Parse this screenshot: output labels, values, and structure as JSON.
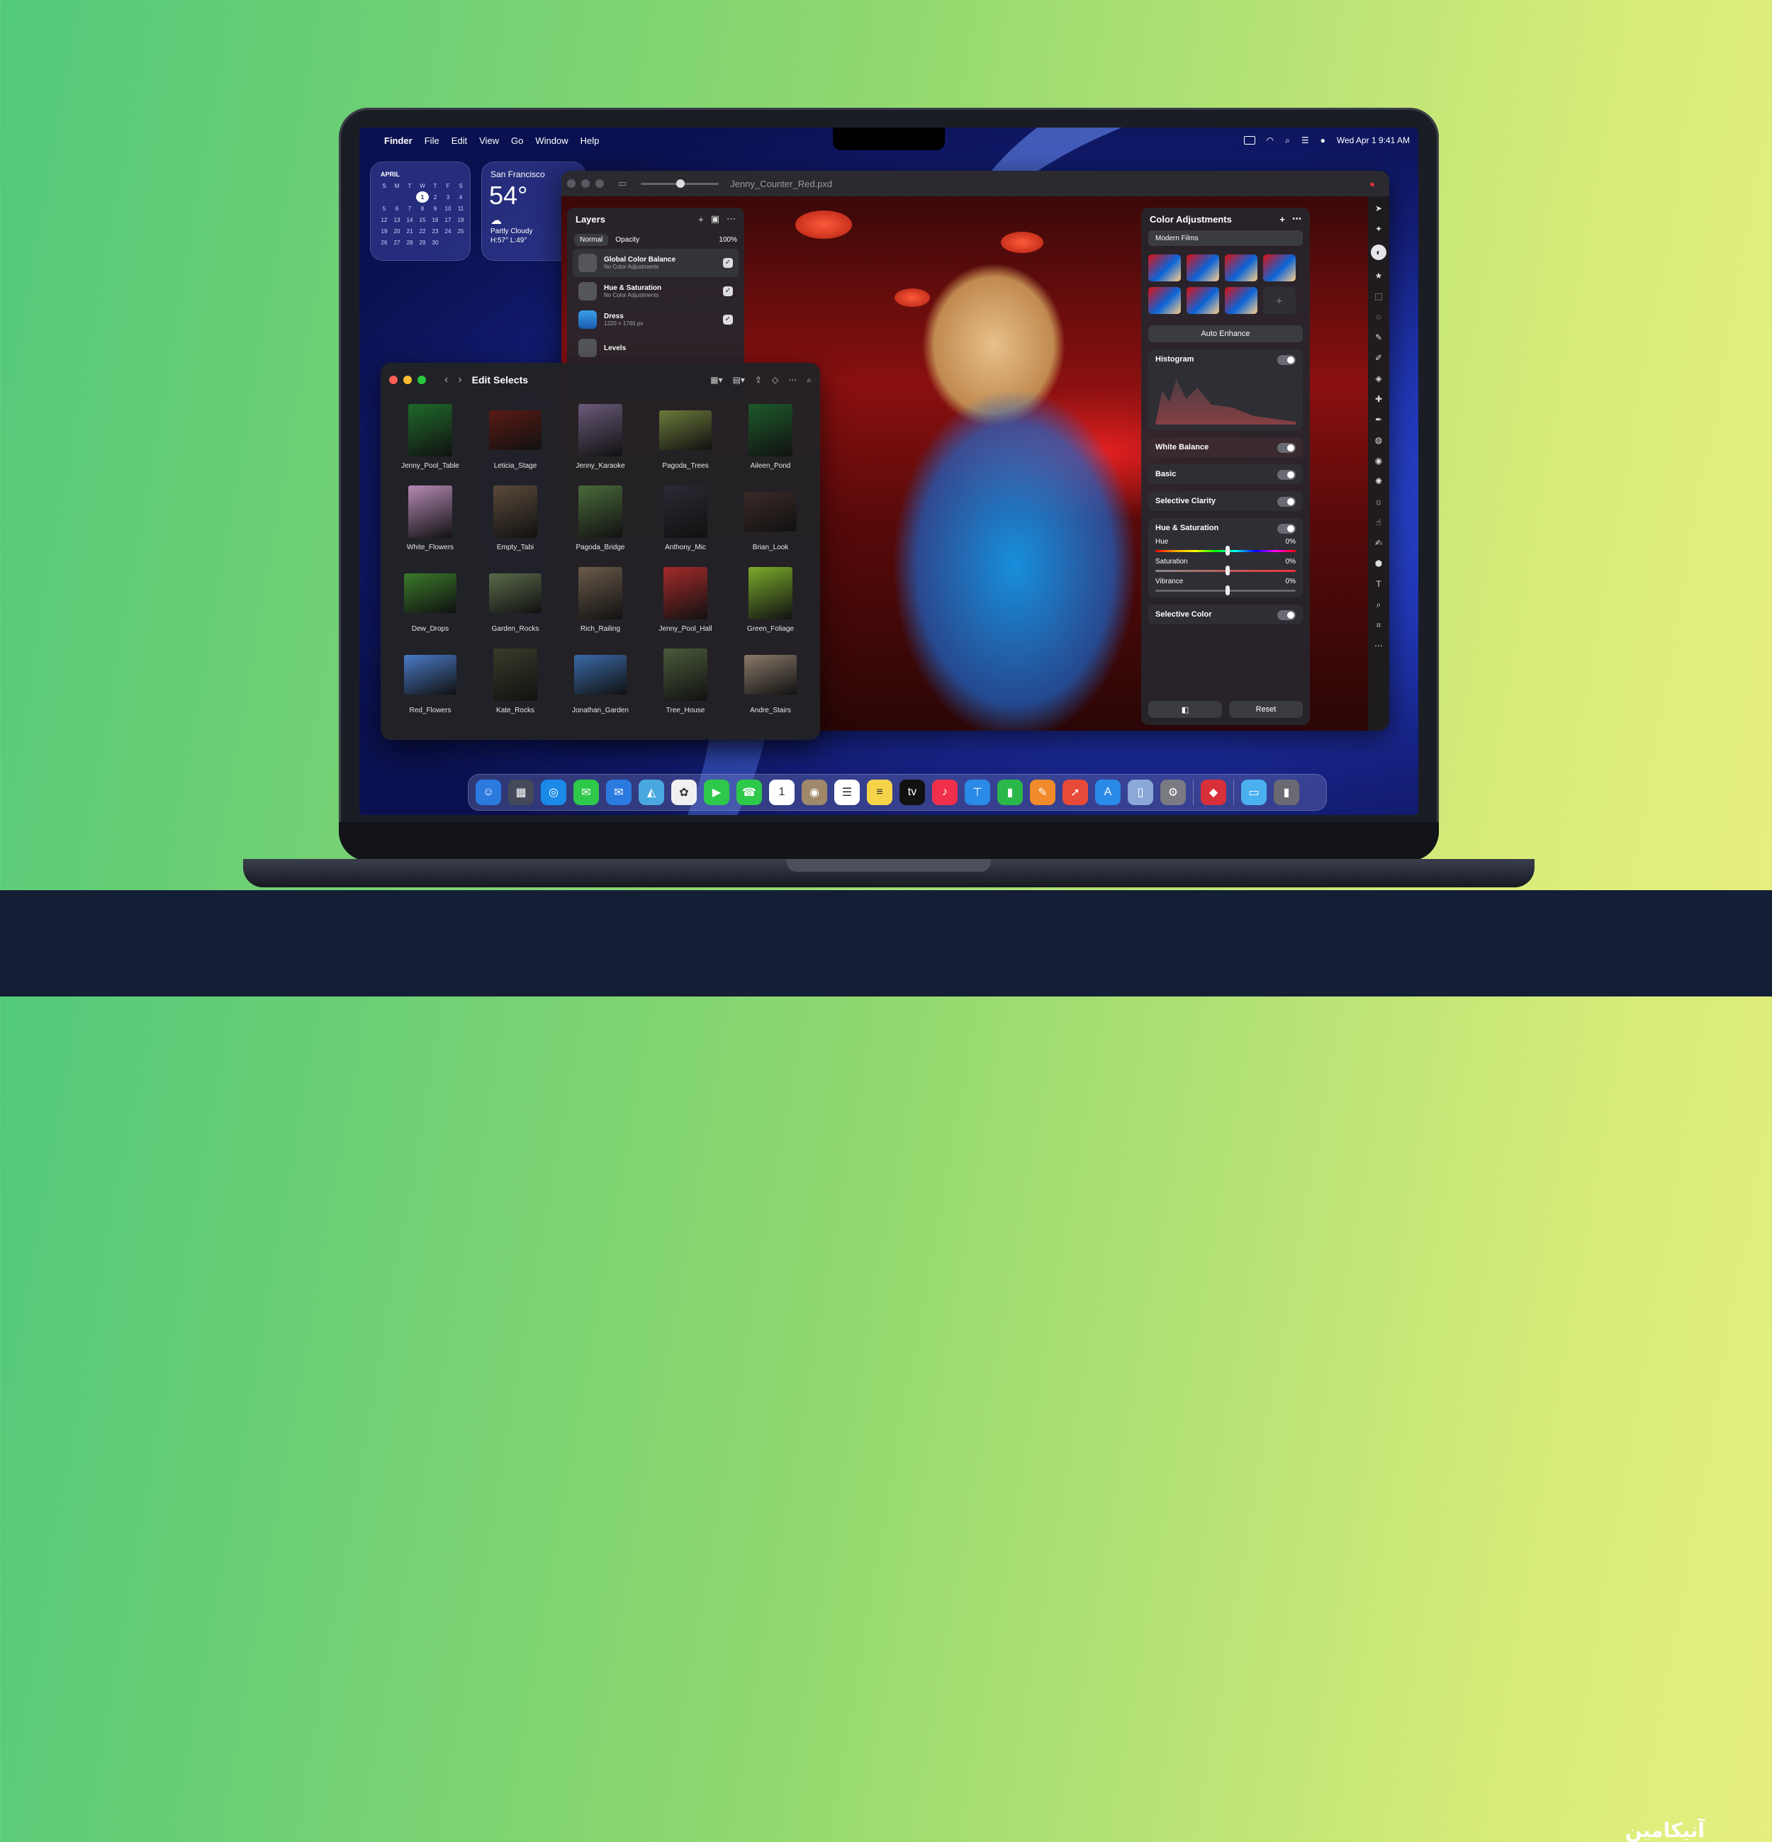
{
  "menubar": {
    "apple_logo": "apple-icon",
    "app_name": "Finder",
    "menus": [
      "File",
      "Edit",
      "View",
      "Go",
      "Window",
      "Help"
    ],
    "datetime": "Wed Apr 1  9:41 AM"
  },
  "calendar_widget": {
    "month": "APRIL",
    "weekdays": [
      "S",
      "M",
      "T",
      "W",
      "T",
      "F",
      "S"
    ],
    "weeks": [
      [
        "",
        "",
        "",
        "1",
        "2",
        "3",
        "4"
      ],
      [
        "5",
        "6",
        "7",
        "8",
        "9",
        "10",
        "11"
      ],
      [
        "12",
        "13",
        "14",
        "15",
        "16",
        "17",
        "18"
      ],
      [
        "19",
        "20",
        "21",
        "22",
        "23",
        "24",
        "25"
      ],
      [
        "26",
        "27",
        "28",
        "29",
        "30",
        "",
        ""
      ]
    ],
    "today": "1"
  },
  "weather_widget": {
    "city": "San Francisco",
    "temperature": "54°",
    "icon": "partly-cloudy-icon",
    "condition": "Partly Cloudy",
    "high_low": "H:57° L:49°"
  },
  "pixelmator": {
    "document_title": "Jenny_Counter_Red.pxd",
    "layers_panel": {
      "title": "Layers",
      "blend_mode": "Normal",
      "opacity_label": "Opacity",
      "opacity_value": "100%",
      "layers": [
        {
          "name": "Global Color Balance",
          "sub": "No Color Adjustments"
        },
        {
          "name": "Hue & Saturation",
          "sub": "No Color Adjustments"
        },
        {
          "name": "Dress",
          "sub": "1220 × 1765 px"
        },
        {
          "name": "Levels",
          "sub": ""
        }
      ]
    },
    "color_adjustments": {
      "title": "Color Adjustments",
      "preset_collection": "Modern Films",
      "auto_enhance": "Auto Enhance",
      "histogram": "Histogram",
      "white_balance": "White Balance",
      "basic": "Basic",
      "selective_clarity": "Selective Clarity",
      "hue_saturation": "Hue & Saturation",
      "hue": {
        "label": "Hue",
        "value": "0%"
      },
      "saturation": {
        "label": "Saturation",
        "value": "0%"
      },
      "vibrance": {
        "label": "Vibrance",
        "value": "0%"
      },
      "selective_color": "Selective Color",
      "reset": "Reset"
    }
  },
  "finder_window": {
    "title": "Edit Selects",
    "items": [
      {
        "label": "Jenny_Pool_Table",
        "color": "#1f6a2a"
      },
      {
        "label": "Leticia_Stage",
        "color": "#5a1a14"
      },
      {
        "label": "Jenny_Karaoke",
        "color": "#6a5a7a"
      },
      {
        "label": "Pagoda_Trees",
        "color": "#6b7a3a"
      },
      {
        "label": "Aileen_Pond",
        "color": "#1d5a2a"
      },
      {
        "label": "White_Flowers",
        "color": "#b48ab4"
      },
      {
        "label": "Empty_Tabi",
        "color": "#5a4a3a"
      },
      {
        "label": "Pagoda_Bridge",
        "color": "#4a6a3a"
      },
      {
        "label": "Anthony_Mic",
        "color": "#2a2a34"
      },
      {
        "label": "Brian_Look",
        "color": "#3a2a28"
      },
      {
        "label": "Dew_Drops",
        "color": "#3a7a2a"
      },
      {
        "label": "Garden_Rocks",
        "color": "#5a6a4a"
      },
      {
        "label": "Rich_Railing",
        "color": "#6a5a4a"
      },
      {
        "label": "Jenny_Pool_Hall",
        "color": "#a42a2a"
      },
      {
        "label": "Green_Foliage",
        "color": "#7aaa2a"
      },
      {
        "label": "Red_Flowers",
        "color": "#4a7ac8"
      },
      {
        "label": "Kate_Rocks",
        "color": "#3a3a2a"
      },
      {
        "label": "Jonathan_Garden",
        "color": "#3a6aa8"
      },
      {
        "label": "Tree_House",
        "color": "#4a5a3a"
      },
      {
        "label": "Andre_Stairs",
        "color": "#8a7a6a"
      }
    ]
  },
  "dock": {
    "apps": [
      {
        "name": "finder-icon",
        "color": "#2a7adf",
        "glyph": "☺"
      },
      {
        "name": "launchpad-icon",
        "color": "#444a5a",
        "glyph": "▦"
      },
      {
        "name": "safari-icon",
        "color": "#1a8ae8",
        "glyph": "◎"
      },
      {
        "name": "messages-icon",
        "color": "#2ec84a",
        "glyph": "✉"
      },
      {
        "name": "mail-icon",
        "color": "#2a7ae0",
        "glyph": "✉"
      },
      {
        "name": "maps-icon",
        "color": "#4aa8e0",
        "glyph": "◭"
      },
      {
        "name": "photos-icon",
        "color": "#f0f0f0",
        "glyph": "✿"
      },
      {
        "name": "facetime-icon",
        "color": "#2ec84a",
        "glyph": "▶"
      },
      {
        "name": "phone-icon",
        "color": "#2ec84a",
        "glyph": "☎"
      },
      {
        "name": "calendar-icon",
        "color": "#ffffff",
        "glyph": "1"
      },
      {
        "name": "contacts-icon",
        "color": "#a0886a",
        "glyph": "◉"
      },
      {
        "name": "reminders-icon",
        "color": "#ffffff",
        "glyph": "☰"
      },
      {
        "name": "notes-icon",
        "color": "#f6d44a",
        "glyph": "≡"
      },
      {
        "name": "tv-icon",
        "color": "#111111",
        "glyph": "tv"
      },
      {
        "name": "music-icon",
        "color": "#f0304a",
        "glyph": "♪"
      },
      {
        "name": "keynote-icon",
        "color": "#2a8ae8",
        "glyph": "⊤"
      },
      {
        "name": "numbers-icon",
        "color": "#2ab84a",
        "glyph": "▮"
      },
      {
        "name": "pages-icon",
        "color": "#f08a2a",
        "glyph": "✎"
      },
      {
        "name": "rocket-icon",
        "color": "#e84a3a",
        "glyph": "➚"
      },
      {
        "name": "app-store-icon",
        "color": "#2a8ae8",
        "glyph": "A"
      },
      {
        "name": "preview-icon",
        "color": "#8aa8d8",
        "glyph": "▯"
      },
      {
        "name": "settings-icon",
        "color": "#7a7a82",
        "glyph": "⚙"
      },
      {
        "name": "pixelmator-icon",
        "color": "#d8303a",
        "glyph": "◆"
      },
      {
        "name": "folder-icon",
        "color": "#4ab0f0",
        "glyph": "▭"
      },
      {
        "name": "trash-icon",
        "color": "#6a6a72",
        "glyph": "▮"
      }
    ]
  },
  "watermark": "آنیکامین"
}
